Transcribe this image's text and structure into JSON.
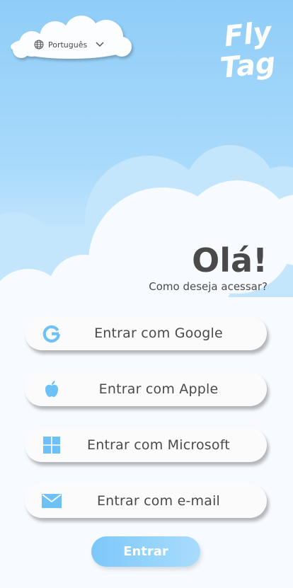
{
  "language": {
    "label": "Português",
    "icon": "globe-icon",
    "chevron": "chevron-down-icon"
  },
  "logo": {
    "line1": "Fly",
    "line2": "Tag"
  },
  "greeting": {
    "title": "Olá!",
    "subtitle": "Como deseja acessar?"
  },
  "login_options": [
    {
      "label": "Entrar com Google",
      "icon": "google-icon"
    },
    {
      "label": "Entrar com Apple",
      "icon": "apple-icon"
    },
    {
      "label": "Entrar com Microsoft",
      "icon": "windows-icon"
    },
    {
      "label": "Entrar com e-mail",
      "icon": "mail-icon"
    }
  ],
  "submit": {
    "label": "Entrar"
  },
  "colors": {
    "accent": "#6ec1f7",
    "text": "#4a4a4a",
    "button_bg": "#fbfbfb"
  }
}
